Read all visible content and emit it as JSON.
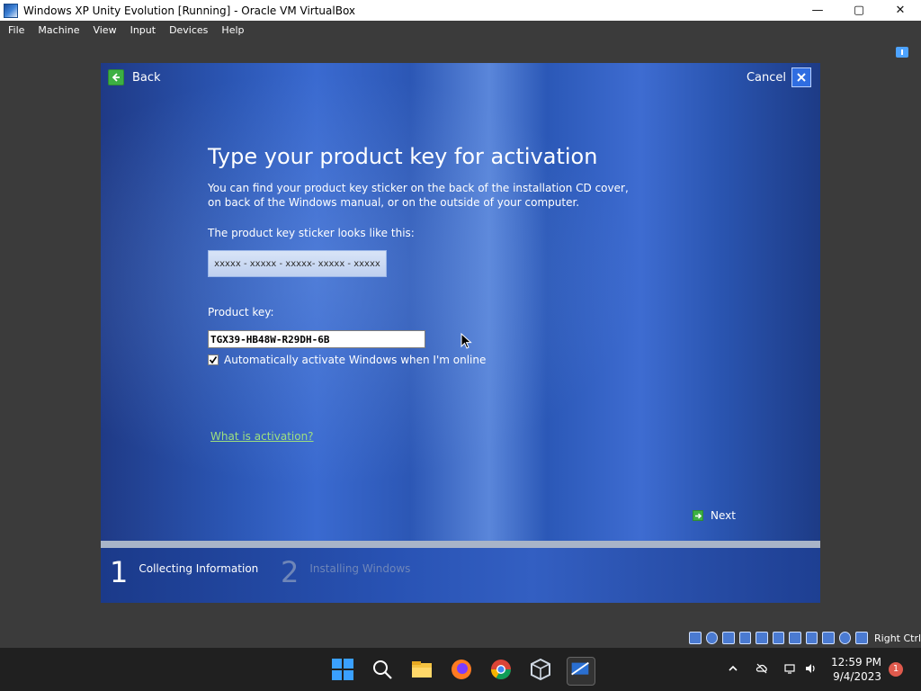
{
  "window": {
    "title": "Windows XP Unity Evolution [Running] - Oracle VM VirtualBox",
    "controls": {
      "minimize": "—",
      "maximize": "▢",
      "close": "✕"
    }
  },
  "menu": [
    "File",
    "Machine",
    "View",
    "Input",
    "Devices",
    "Help"
  ],
  "wizard": {
    "back_label": "Back",
    "cancel_label": "Cancel",
    "heading": "Type your product key for activation",
    "description": "You can find your product key sticker on the back of the installation CD cover, on back of the Windows manual, or on the outside of your computer.",
    "sticker_label": "The product key sticker looks like this:",
    "sticker_example": "xxxxx - xxxxx - xxxxx- xxxxx - xxxxx",
    "product_key_label": "Product key:",
    "product_key_value": "TGX39-HB48W-R29DH-6B",
    "auto_activate_label": "Automatically activate Windows when I'm online",
    "auto_activate_checked": true,
    "activation_link": "What is activation?",
    "next_label": "Next",
    "steps": [
      {
        "num": "1",
        "label": "Collecting Information",
        "active": true
      },
      {
        "num": "2",
        "label": "Installing Windows",
        "active": false
      }
    ]
  },
  "vbox_status": {
    "host_key": "Right Ctrl"
  },
  "taskbar": {
    "apps": [
      "windows-start-icon",
      "search-icon",
      "file-explorer-icon",
      "firefox-icon",
      "chrome-icon",
      "virtualbox-icon",
      "windows-xp-vm-icon"
    ],
    "time": "12:59 PM",
    "date": "9/4/2023",
    "notification_count": "1"
  },
  "colors": {
    "wizard_blue": "#2b56b4",
    "link_green": "#9ee07f",
    "taskbar": "#202020"
  }
}
